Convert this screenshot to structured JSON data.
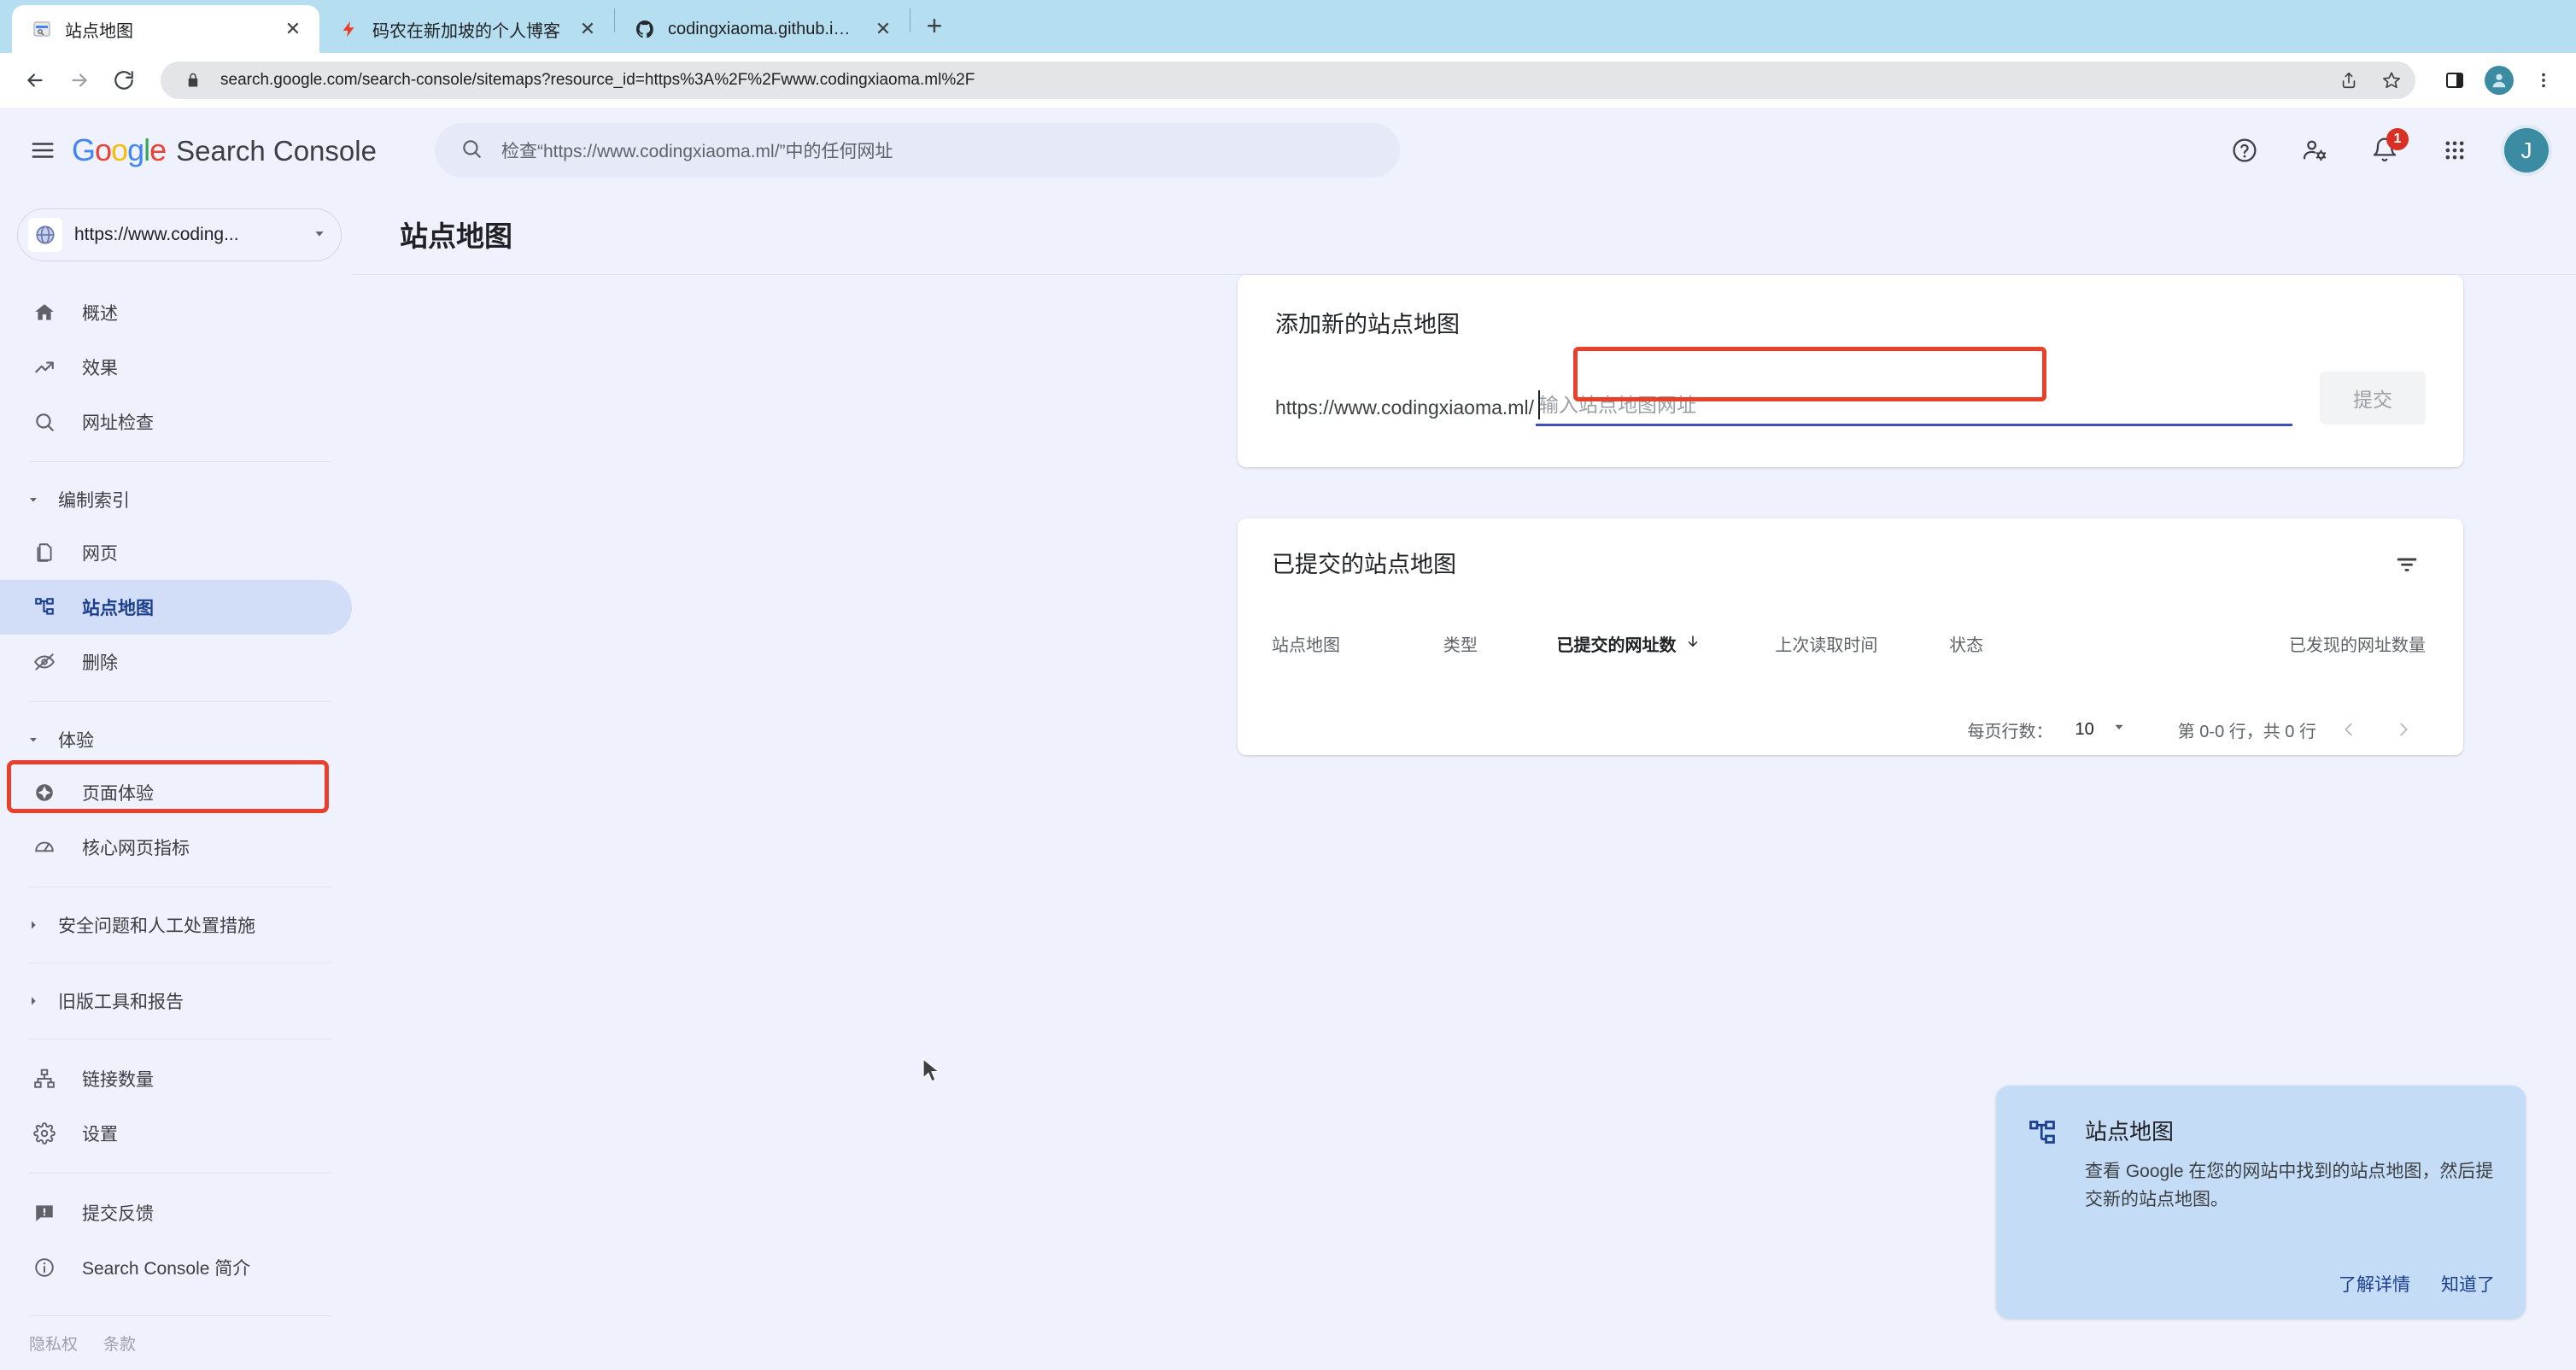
{
  "browser": {
    "tabs": [
      {
        "title": "站点地图",
        "favicon": "search-console-icon",
        "active": true
      },
      {
        "title": "码农在新加坡的个人博客",
        "favicon": "lightning-icon",
        "active": false
      },
      {
        "title": "codingxiaoma.github.io/sitema",
        "favicon": "github-icon",
        "active": false
      }
    ],
    "new_tab_label": "+",
    "close_label": "✕",
    "url": "search.google.com/search-console/sitemaps?resource_id=https%3A%2F%2Fwww.codingxiaoma.ml%2F",
    "nav": {
      "back": "back-arrow",
      "forward": "forward-arrow",
      "reload": "reload-icon"
    }
  },
  "header": {
    "menu_icon": "hamburger-icon",
    "brand_google": [
      "G",
      "o",
      "o",
      "g",
      "l",
      "e"
    ],
    "brand_product": "Search Console",
    "search_placeholder": "检查“https://www.codingxiaoma.ml/”中的任何网址",
    "help_icon": "help-icon",
    "account_settings_icon": "account-settings-icon",
    "notifications_icon": "bell-icon",
    "notification_count": "1",
    "apps_icon": "apps-grid-icon",
    "avatar_initial": "J"
  },
  "sidebar": {
    "property": {
      "label": "https://www.coding...",
      "favicon": "globe-icon"
    },
    "items": [
      {
        "label": "概述",
        "icon": "home-icon",
        "type": "item"
      },
      {
        "label": "效果",
        "icon": "trending-up-icon",
        "type": "item"
      },
      {
        "label": "网址检查",
        "icon": "search-icon",
        "type": "item"
      },
      {
        "label": "编制索引",
        "icon": "caret-down-icon",
        "type": "group-open"
      },
      {
        "label": "网页",
        "icon": "pages-icon",
        "type": "item"
      },
      {
        "label": "站点地图",
        "icon": "sitemap-icon",
        "type": "item",
        "selected": true
      },
      {
        "label": "删除",
        "icon": "eye-off-icon",
        "type": "item"
      },
      {
        "label": "体验",
        "icon": "caret-down-icon",
        "type": "group-open"
      },
      {
        "label": "页面体验",
        "icon": "page-experience-icon",
        "type": "item"
      },
      {
        "label": "核心网页指标",
        "icon": "speedometer-icon",
        "type": "item"
      },
      {
        "label": "安全问题和人工处置措施",
        "icon": "caret-right-icon",
        "type": "group-closed"
      },
      {
        "label": "旧版工具和报告",
        "icon": "caret-right-icon",
        "type": "group-closed"
      },
      {
        "label": "链接数量",
        "icon": "links-icon",
        "type": "item"
      },
      {
        "label": "设置",
        "icon": "gear-icon",
        "type": "item"
      },
      {
        "label": "提交反馈",
        "icon": "feedback-icon",
        "type": "item"
      },
      {
        "label": "Search Console 简介",
        "icon": "info-icon",
        "type": "item"
      }
    ],
    "legal": [
      "隐私权",
      "条款"
    ]
  },
  "page": {
    "title": "站点地图"
  },
  "add_sitemap_card": {
    "title": "添加新的站点地图",
    "url_prefix": "https://www.codingxiaoma.ml/",
    "input_placeholder": "输入站点地图网址",
    "input_value": "",
    "submit_label": "提交"
  },
  "submitted_card": {
    "title": "已提交的站点地图",
    "filter_icon": "filter-icon",
    "columns": [
      {
        "label": "站点地图",
        "sorted": false
      },
      {
        "label": "类型",
        "sorted": false
      },
      {
        "label": "已提交的网址数",
        "sorted": true,
        "sort_icon": "arrow-down-icon"
      },
      {
        "label": "上次读取时间",
        "sorted": false
      },
      {
        "label": "状态",
        "sorted": false
      },
      {
        "label": "已发现的网址数量",
        "sorted": false
      }
    ],
    "rows": [],
    "pagination": {
      "rows_per_page_label": "每页行数：",
      "rows_per_page_value": "10",
      "dropdown_icon": "caret-down-icon",
      "range_label": "第 0-0 行，共 0 行",
      "prev_icon": "chevron-left-icon",
      "next_icon": "chevron-right-icon"
    }
  },
  "toast": {
    "icon": "sitemap-icon",
    "title": "站点地图",
    "text": "查看 Google 在您的网站中找到的站点地图，然后提交新的站点地图。",
    "learn_more": "了解详情",
    "dismiss": "知道了"
  },
  "annotations": {
    "highlight_color": "#e8402a",
    "sidebar_target": "站点地图",
    "input_target": "输入站点地图网址"
  }
}
